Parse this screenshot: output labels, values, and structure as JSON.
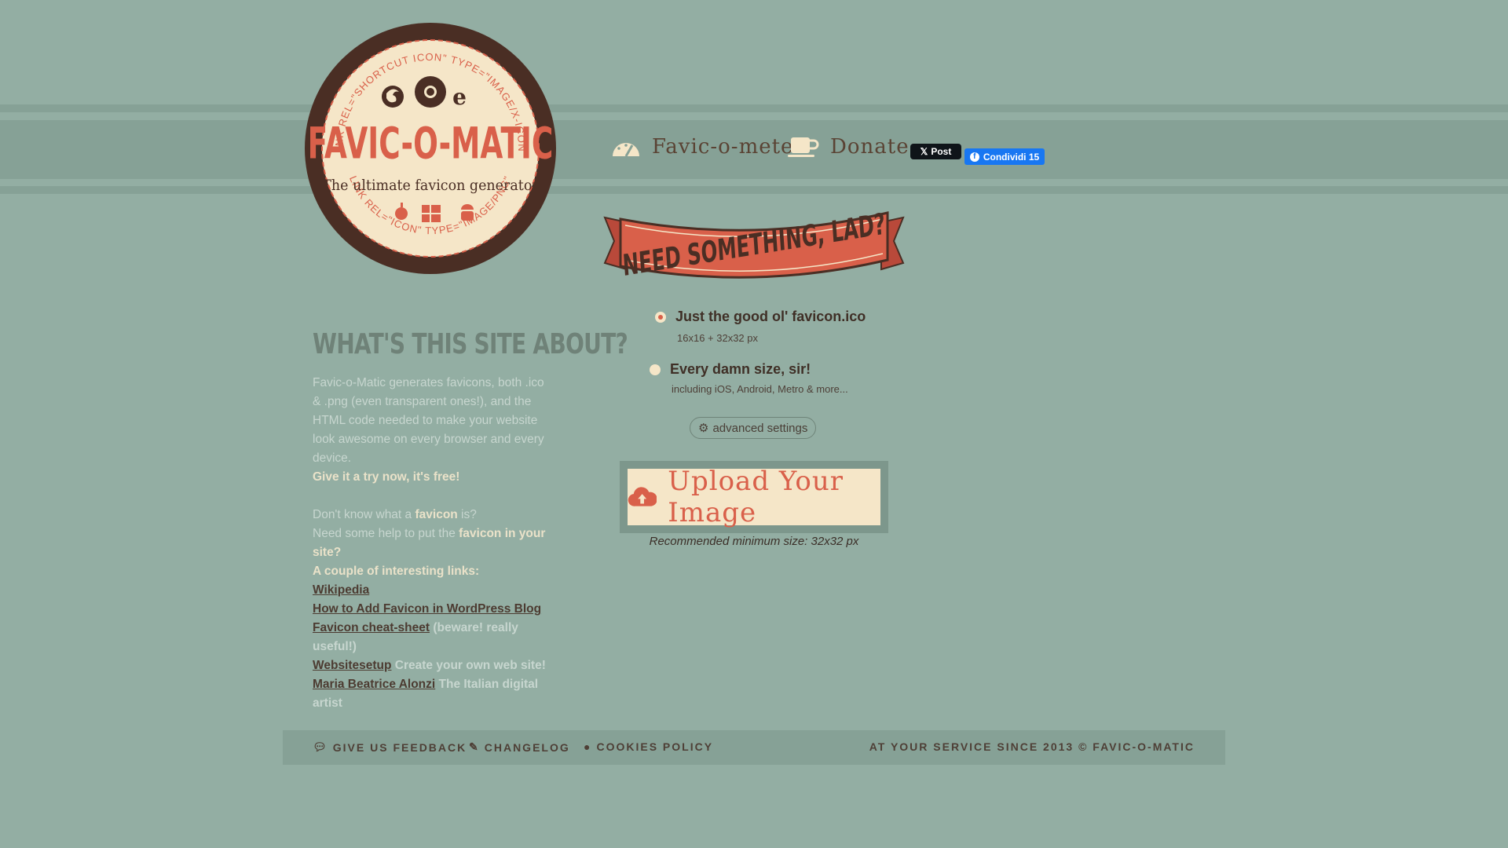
{
  "badge": {
    "title": "FAVIC-O-MATIC",
    "subtitle": "The ultimate favicon generator",
    "arc_top": "LINK REL=\"SHORTCUT ICON\" TYPE=\"IMAGE/X-ICON\"",
    "arc_bottom": "LINK REL=\"ICON\" TYPE=\"IMAGE/PNG\""
  },
  "nav": {
    "meter_label": "Favic-o-meter",
    "donate_label": "Donate",
    "tweet_label": "Post",
    "share_label": "Condividi 15"
  },
  "ribbon": {
    "text": "NEED SOMETHING, LAD?"
  },
  "options": [
    {
      "title": "Just the good ol' favicon.ico",
      "sub": "16x16 + 32x32 px",
      "selected": true
    },
    {
      "title": "Every damn size, sir!",
      "sub": "including iOS, Android, Metro & more...",
      "selected": false
    }
  ],
  "advanced": "advanced settings",
  "upload": {
    "label": "Upload Your Image",
    "recommendation": "Recommended minimum size: 32x32 px"
  },
  "about": {
    "title": "WHAT'S THIS SITE ABOUT?",
    "intro": "Favic-o-Matic generates favicons, both .ico & .png (even transparent ones!), and the HTML code needed to make your website look awesome on every browser and every device.",
    "cta": "Give it a try now, it's free!",
    "q1_pre": "Don't know what a ",
    "q1_bold": "favicon",
    "q1_post": " is?",
    "q2_pre": "Need some help to put the ",
    "q2_bold": "favicon in your site?",
    "links_heading": "A couple of interesting links:",
    "links": [
      {
        "text": "Wikipedia",
        "note": ""
      },
      {
        "text": "How to Add Favicon in WordPress Blog",
        "note": ""
      },
      {
        "text": "Favicon cheat-sheet",
        "note": " (beware! really useful!)"
      },
      {
        "text": "Websitesetup",
        "note": " Create your own web site!"
      },
      {
        "text": "Maria Beatrice Alonzi",
        "note": " The Italian digital artist"
      }
    ]
  },
  "footer": {
    "feedback": "GIVE US FEEDBACK",
    "changelog": "CHANGELOG",
    "cookies": "COOKIES POLICY",
    "copyright": "AT YOUR SERVICE SINCE 2013 © FAVIC-O-MATIC"
  },
  "colors": {
    "background": "#93aea3",
    "accent_red": "#d9604a",
    "cream": "#f5e6c8",
    "dark_brown": "#4a2e24"
  }
}
